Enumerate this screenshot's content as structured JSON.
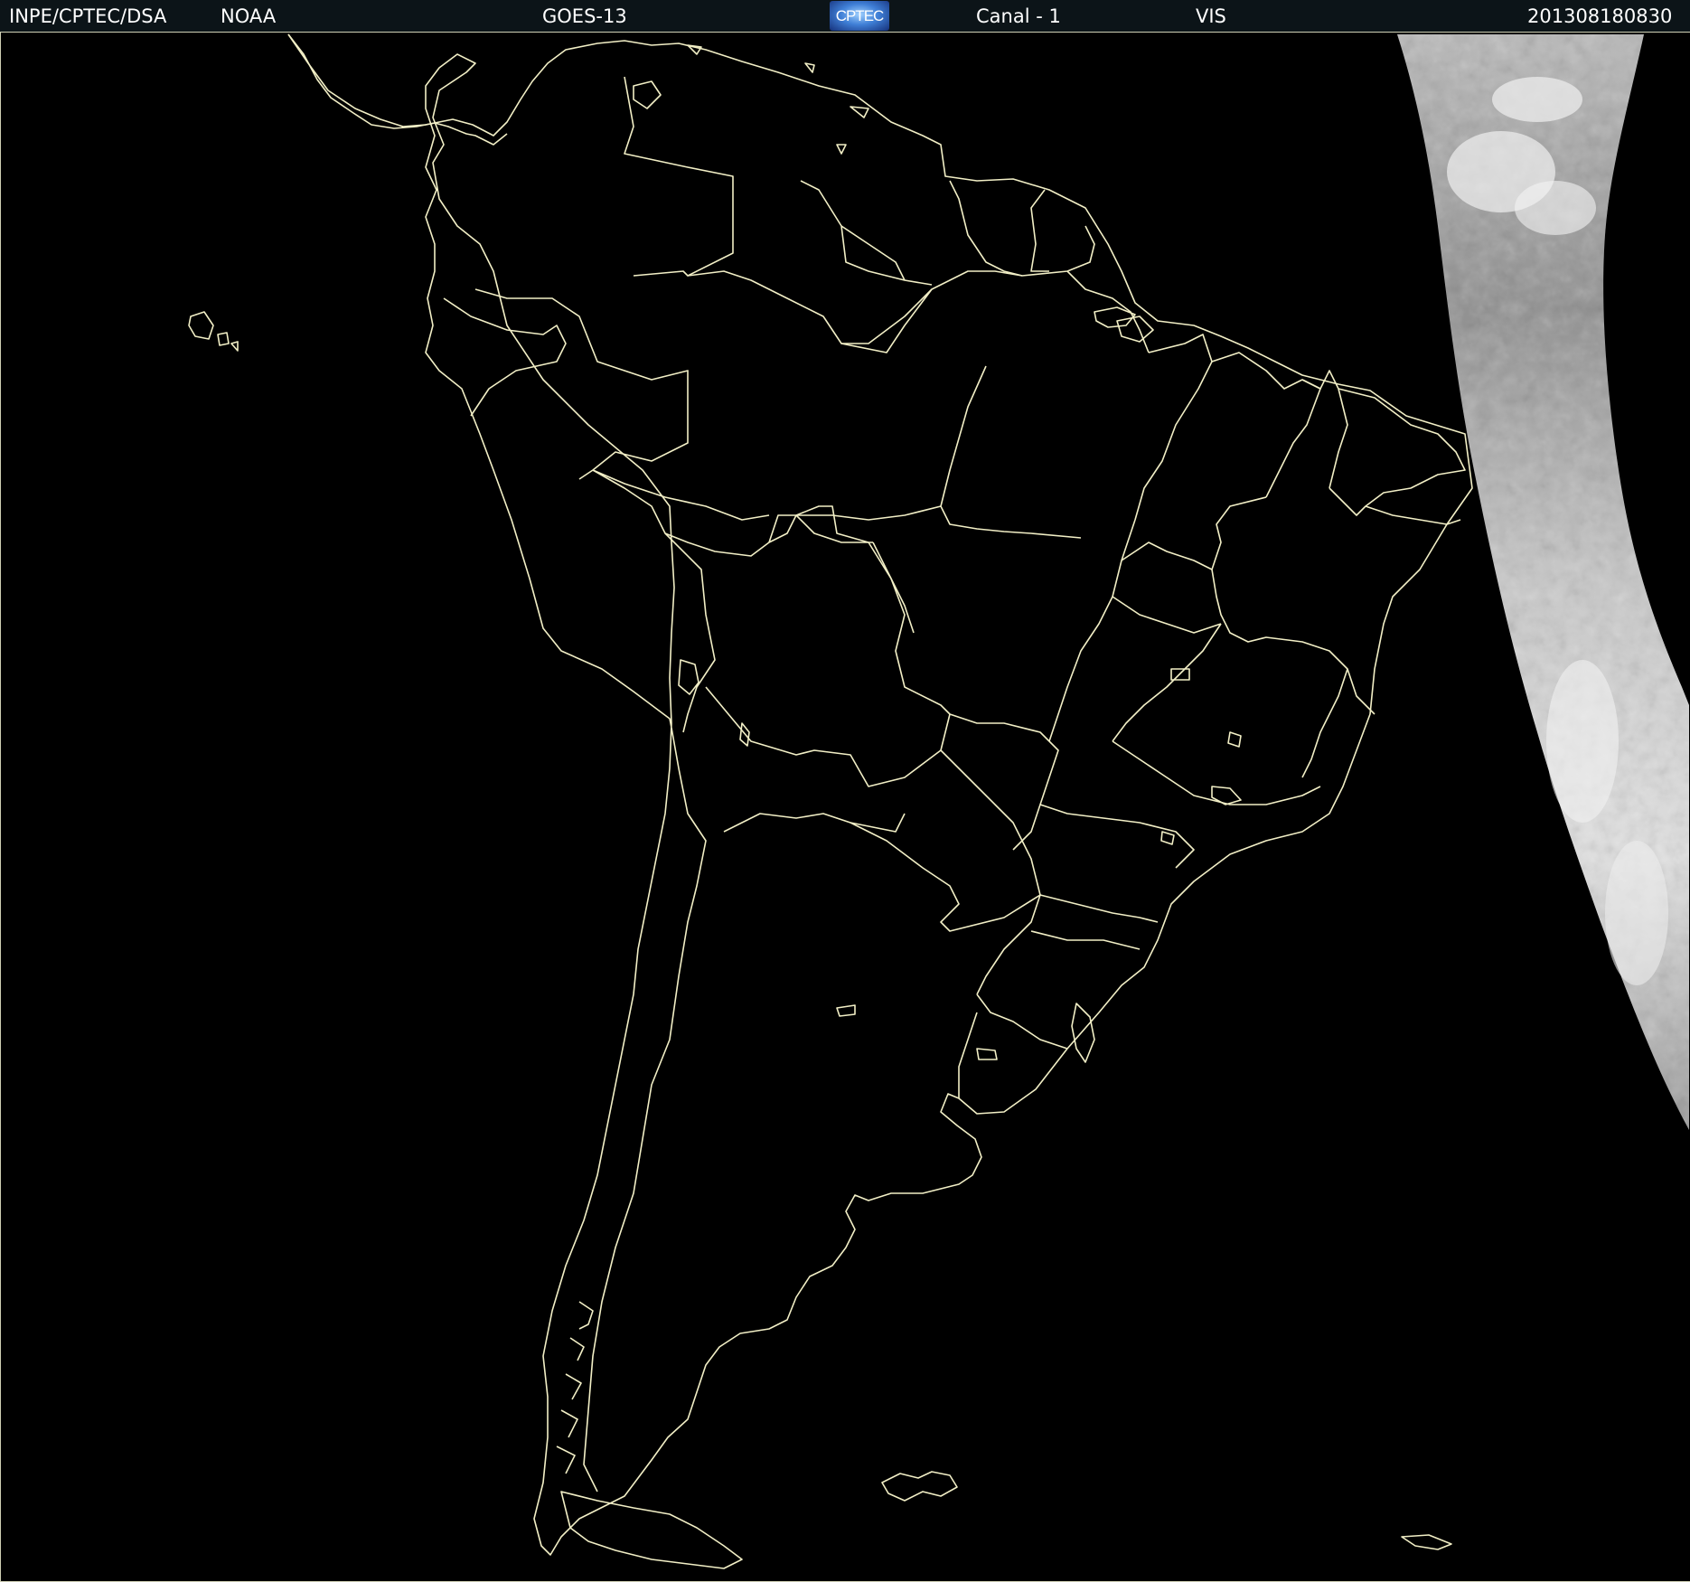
{
  "header": {
    "org": "INPE/CPTEC/DSA",
    "agency": "NOAA",
    "satellite": "GOES-13",
    "logo_text": "CPTEC",
    "channel": "Canal - 1",
    "band": "VIS",
    "timestamp": "201308180830"
  },
  "colors": {
    "background": "#000000",
    "header_bg": "#0c1418",
    "outline": "#f2efc6",
    "cloud_light": "#e6e6e6",
    "cloud_dark": "#8a8a8a"
  },
  "icons": {
    "logo": "cptec-logo"
  }
}
